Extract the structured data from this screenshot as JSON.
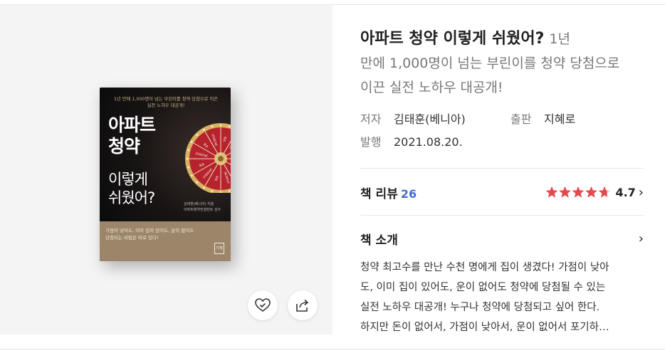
{
  "book": {
    "title": "아파트 청약 이렇게 쉬웠어?",
    "subtitle_line1": "1년",
    "subtitle_line2": "만에 1,000명이 넘는 부린이를 청약 당첨으로",
    "subtitle_line3": "이끈 실전 노하우 대공개!",
    "cover": {
      "tagline": "1년 만에 1,000명이 넘는 부린이를 청약 당첨으로 이끈\n실전 노하우 대공개!",
      "title_top": "아파트\n청약",
      "title_bottom": "이렇게\n쉬웠어?",
      "author_small": "김태훈(베니아) 지음\n아파트청약컨설턴트 감수",
      "blurb": "가점이 낮아도, 이미 집이 있어도, 운이 없어도\n당첨되는 비법은 따로 있다!",
      "logo": "지혜",
      "wheel_labels": [
        "JACKPOT",
        "당첨",
        "JACKPOT",
        "당첨",
        "JACKPOT",
        "당첨",
        "JACKPOT",
        "당첨",
        "JACKPOT",
        "당첨",
        "JACKPOT",
        "당첨"
      ]
    }
  },
  "meta": {
    "author_label": "저자",
    "author_value": "김태훈(베니아)",
    "publisher_label": "출판",
    "publisher_value": "지혜로",
    "date_label": "발행",
    "date_value": "2021.08.20."
  },
  "review": {
    "label": "책 리뷰",
    "count": "26",
    "rating": "4.7",
    "rating_value": 4.7,
    "max_stars": 5,
    "star_color": "#e5484d"
  },
  "intro": {
    "label": "책 소개",
    "lines": [
      "청약 최고수를 만난 수천 명에게 집이 생겼다! 가점이 낮아",
      "도, 이미 집이 있어도, 운이 없어도 청약에 당첨될 수 있는",
      "실전 노하우 대공개! 누구나 청약에 당첨되고 싶어 한다.",
      "하지만 돈이 없어서, 가점이 낮아서, 운이 없어서 포기하…"
    ]
  },
  "actions": {
    "like_icon": "heart-check-icon",
    "share_icon": "share-icon"
  },
  "colors": {
    "accent_blue": "#3f6fd1",
    "star_red": "#e5484d",
    "cover_bottom": "#9c8568"
  }
}
